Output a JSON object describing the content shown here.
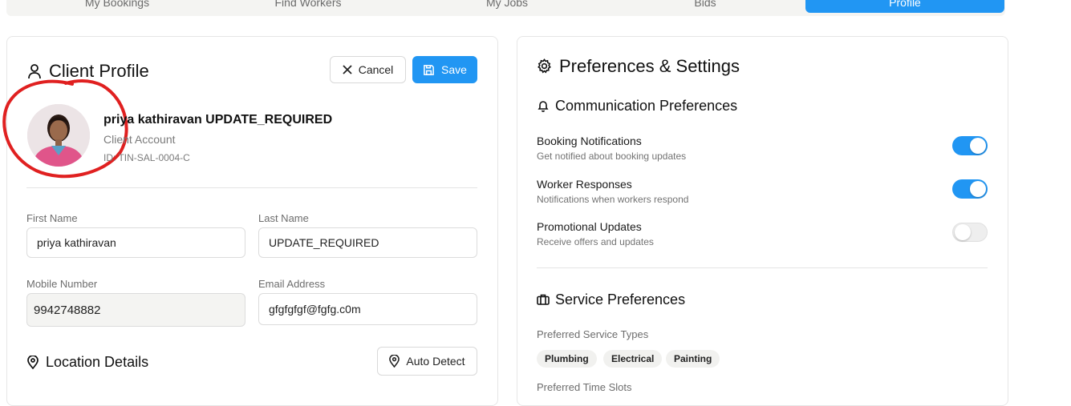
{
  "tabs": [
    {
      "label": "My Bookings",
      "active": false
    },
    {
      "label": "Find Workers",
      "active": false
    },
    {
      "label": "My Jobs",
      "active": false
    },
    {
      "label": "Bids",
      "active": false
    },
    {
      "label": "Profile",
      "active": true
    }
  ],
  "profile": {
    "title": "Client Profile",
    "cancel_label": "Cancel",
    "save_label": "Save",
    "full_name": "priya kathiravan UPDATE_REQUIRED",
    "account_type": "Client Account",
    "id_text": "ID: TIN-SAL-0004-C",
    "fields": {
      "first_name_label": "First Name",
      "first_name_value": "priya kathiravan",
      "last_name_label": "Last Name",
      "last_name_value": "UPDATE_REQUIRED",
      "mobile_label": "Mobile Number",
      "mobile_value": "9942748882",
      "email_label": "Email Address",
      "email_value": "gfgfgfgf@fgfg.c0m"
    },
    "location_title": "Location Details",
    "auto_detect_label": "Auto Detect"
  },
  "preferences": {
    "title": "Preferences & Settings",
    "communication_title": "Communication Preferences",
    "items": [
      {
        "title": "Booking Notifications",
        "desc": "Get notified about booking updates",
        "enabled": true
      },
      {
        "title": "Worker Responses",
        "desc": "Notifications when workers respond",
        "enabled": true
      },
      {
        "title": "Promotional Updates",
        "desc": "Receive offers and updates",
        "enabled": false
      }
    ],
    "service_title": "Service Preferences",
    "service_types_label": "Preferred Service Types",
    "service_types": [
      "Plumbing",
      "Electrical",
      "Painting"
    ],
    "time_slots_label": "Preferred Time Slots"
  },
  "colors": {
    "accent": "#2196f3",
    "annotation": "#e02020"
  },
  "icons": {
    "user": "user-icon",
    "cancel": "close-icon",
    "save": "save-icon",
    "location": "map-pin-icon",
    "settings": "gear-icon",
    "bell": "bell-icon",
    "briefcase": "briefcase-icon"
  }
}
